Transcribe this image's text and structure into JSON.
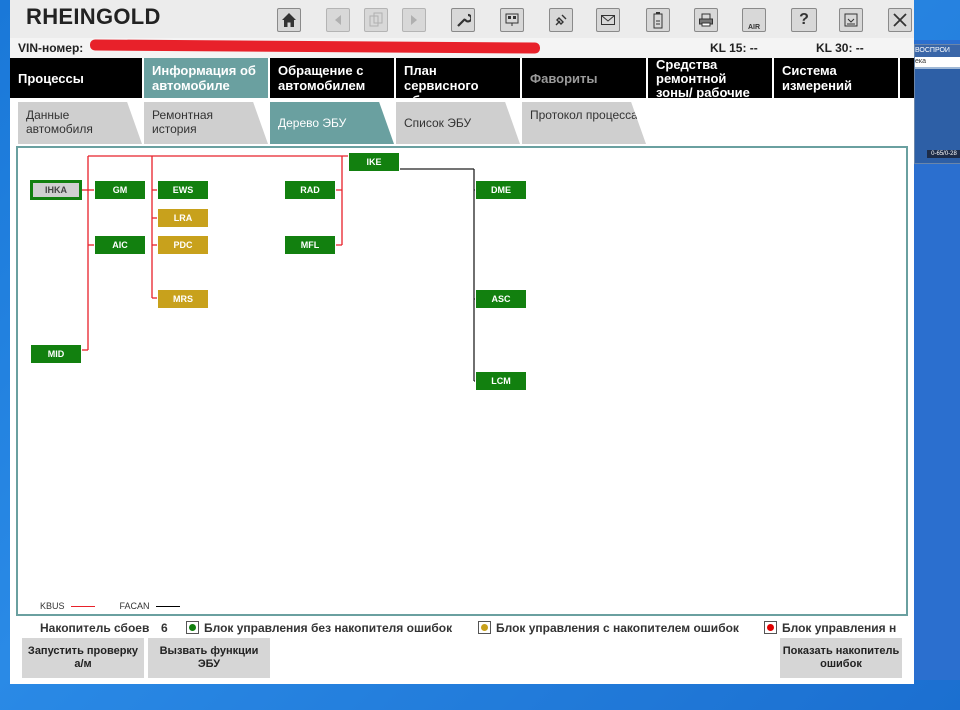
{
  "app": {
    "title": "RHEINGOLD"
  },
  "toolbar": {
    "buttons": [
      {
        "name": "home-icon",
        "enabled": true
      },
      {
        "name": "back-icon",
        "enabled": false
      },
      {
        "name": "copy-icon",
        "enabled": false
      },
      {
        "name": "forward-icon",
        "enabled": false
      },
      {
        "name": "wrench-icon",
        "enabled": true
      },
      {
        "name": "diagnosis-icon",
        "enabled": true
      },
      {
        "name": "plug-icon",
        "enabled": true
      },
      {
        "name": "mail-icon",
        "enabled": true
      },
      {
        "name": "battery-icon",
        "enabled": true
      },
      {
        "name": "print-icon",
        "enabled": true
      },
      {
        "name": "air-icon",
        "enabled": true,
        "label": "AIR"
      },
      {
        "name": "help-icon",
        "enabled": true,
        "label": "?"
      },
      {
        "name": "minimize-icon",
        "enabled": true
      },
      {
        "name": "close-icon",
        "enabled": true
      }
    ]
  },
  "vin": {
    "label": "VIN-номер:",
    "kl15": "KL 15:  --",
    "kl30": "KL 30:  --"
  },
  "main_nav": [
    {
      "label": "Процессы"
    },
    {
      "label": "Информация об автомобиле"
    },
    {
      "label": "Обращение с автомобилем"
    },
    {
      "label": "План сервисного обслуживания"
    },
    {
      "label": "Фавориты"
    },
    {
      "label": "Средства ремонтной зоны/ рабочие жидкости"
    },
    {
      "label": "Система измерений"
    }
  ],
  "sub_nav": [
    {
      "label": "Данные автомобиля"
    },
    {
      "label": "Ремонтная история"
    },
    {
      "label": "Дерево ЭБУ"
    },
    {
      "label": "Список ЭБУ"
    },
    {
      "label": "Протокол процесса"
    }
  ],
  "ecus": [
    {
      "id": "IHKA",
      "status": "unknown"
    },
    {
      "id": "GM",
      "status": "ok"
    },
    {
      "id": "EWS",
      "status": "ok"
    },
    {
      "id": "LRA",
      "status": "fault"
    },
    {
      "id": "AIC",
      "status": "ok"
    },
    {
      "id": "PDC",
      "status": "fault"
    },
    {
      "id": "MRS",
      "status": "fault"
    },
    {
      "id": "MID",
      "status": "ok"
    },
    {
      "id": "RAD",
      "status": "ok"
    },
    {
      "id": "MFL",
      "status": "ok"
    },
    {
      "id": "IKE",
      "status": "ok"
    },
    {
      "id": "DME",
      "status": "ok"
    },
    {
      "id": "ASC",
      "status": "ok"
    },
    {
      "id": "LCM",
      "status": "ok"
    }
  ],
  "legend": {
    "kbus": "KBUS",
    "facan": "FACAN",
    "kbus_color": "#e8212a",
    "facan_color": "#000000"
  },
  "status": {
    "fault_label": "Накопитель сбоев",
    "fault_count": "6",
    "ok_label": "Блок управления без накопителя ошибок",
    "fault_mem_label": "Блок управления с накопителем ошибок",
    "no_comm_label": "Блок управления н",
    "colors": {
      "ok": "#12800f",
      "fault": "#c8a11c",
      "no_comm": "#e00000"
    }
  },
  "buttons": {
    "start_check": "Запустить проверку а/м",
    "call_functions": "Вызвать функции ЭБУ",
    "show_faults": "Показать накопитель ошибок"
  },
  "desktop": {
    "window_title": "ВОСПРОИ",
    "window_addr": "ека",
    "window_tag": "0-65/0-28"
  }
}
